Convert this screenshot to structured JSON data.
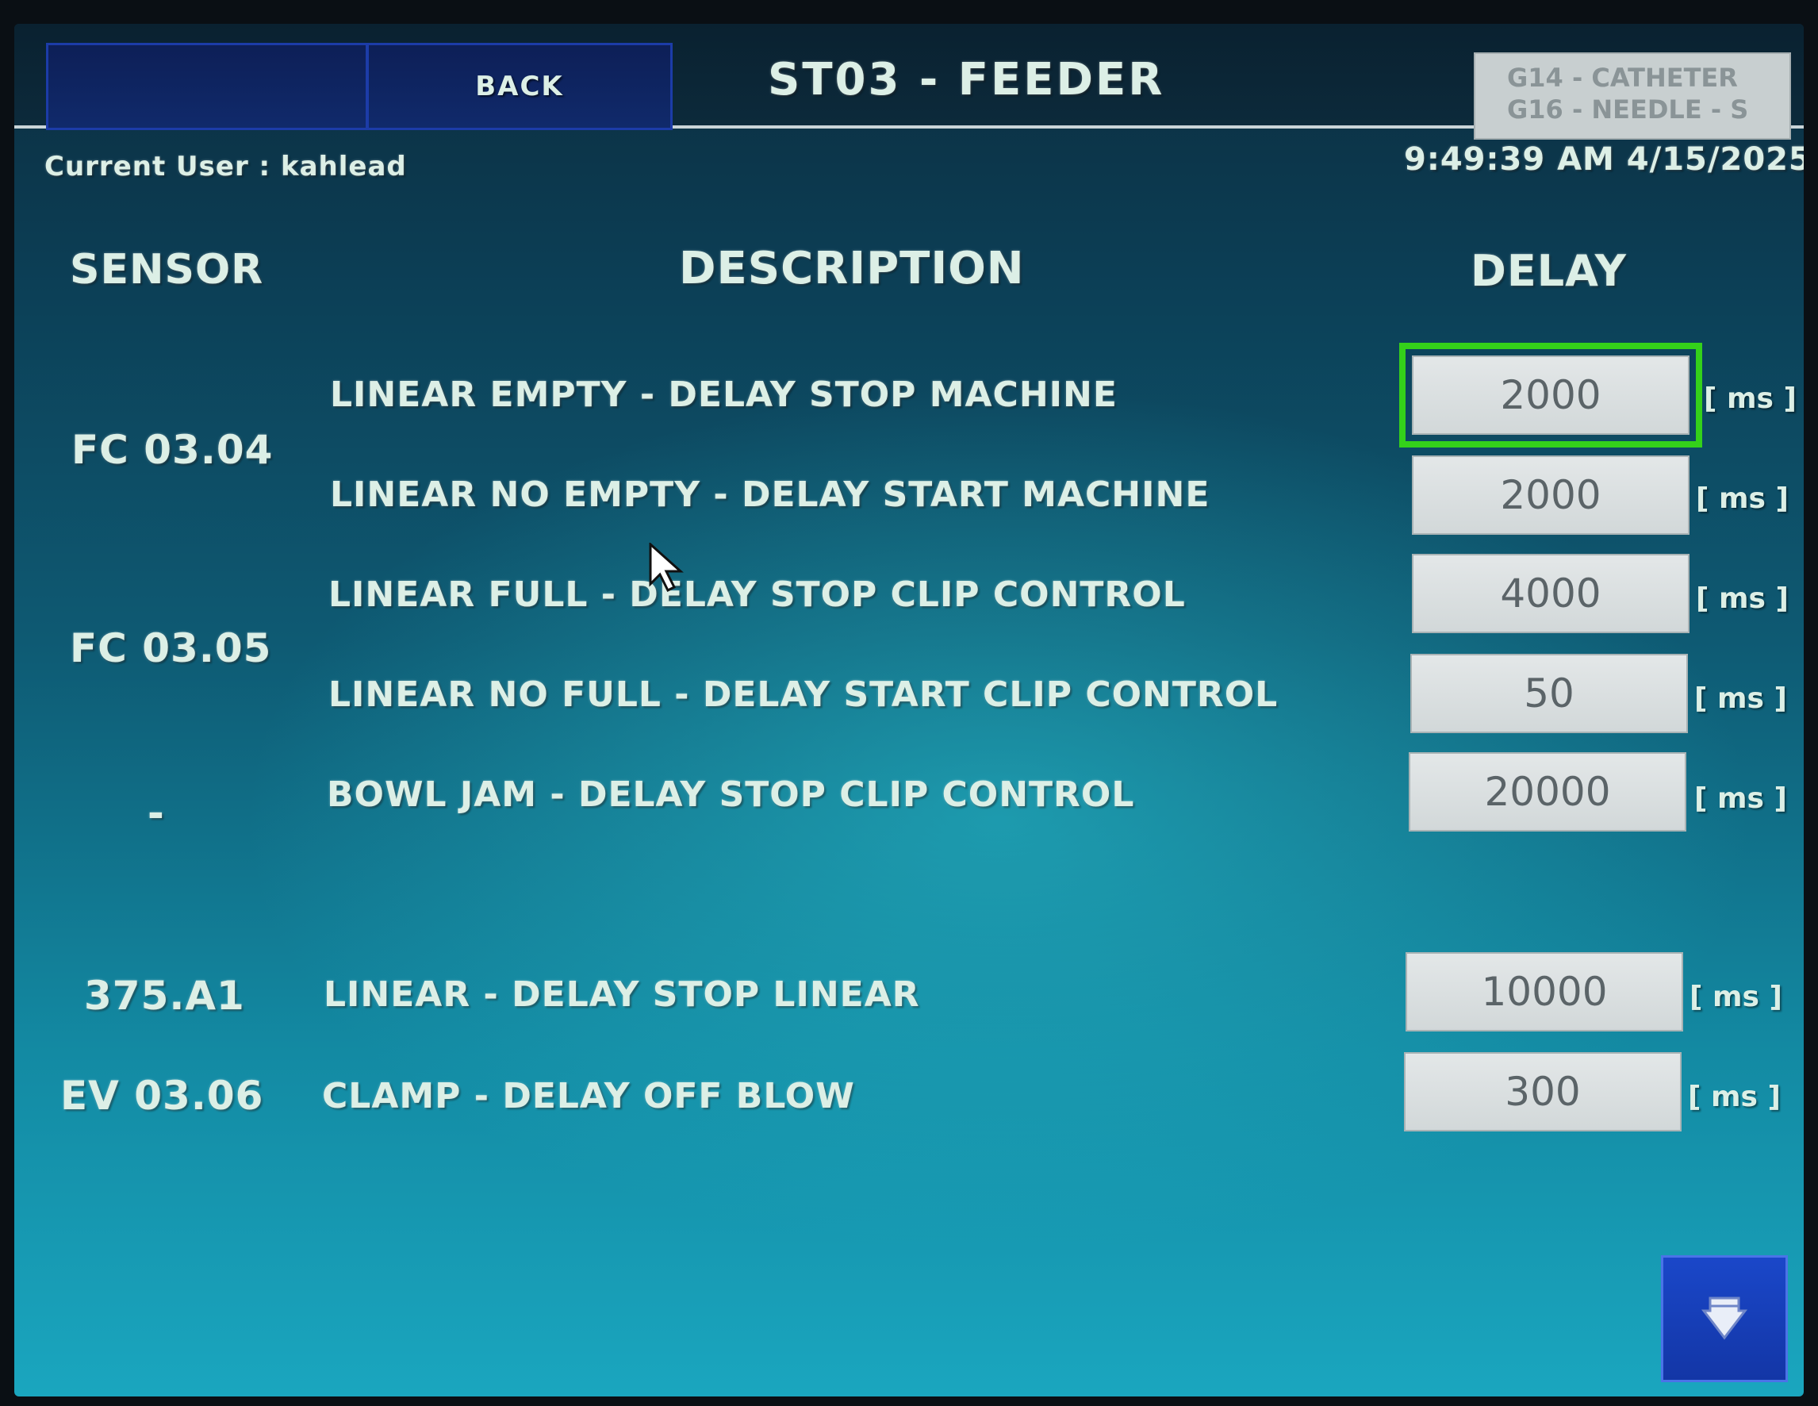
{
  "header": {
    "title": "ST03 - FEEDER",
    "back_label": "BACK",
    "recipe_line1": "G14 - CATHETER",
    "recipe_line2": "G16 - NEEDLE - S"
  },
  "status": {
    "current_user": "Current User : kahlead",
    "datetime": "9:49:39 AM 4/15/2025"
  },
  "columns": {
    "sensor": "SENSOR",
    "description": "DESCRIPTION",
    "delay": "DELAY"
  },
  "sensors": {
    "fc0304": "FC 03.04",
    "fc0305": "FC 03.05",
    "dash": "-",
    "a375": "375.A1",
    "ev0306": "EV 03.06"
  },
  "rows": [
    {
      "description": "LINEAR EMPTY - DELAY STOP MACHINE",
      "value": "2000",
      "unit": "[ ms ]"
    },
    {
      "description": "LINEAR NO EMPTY - DELAY START MACHINE",
      "value": "2000",
      "unit": "[ ms ]"
    },
    {
      "description": "LINEAR FULL - DELAY STOP CLIP CONTROL",
      "value": "4000",
      "unit": "[ ms ]"
    },
    {
      "description": "LINEAR NO FULL - DELAY START CLIP CONTROL",
      "value": "50",
      "unit": "[ ms ]"
    },
    {
      "description": "BOWL JAM - DELAY STOP CLIP CONTROL",
      "value": "20000",
      "unit": "[ ms ]"
    },
    {
      "description": "LINEAR - DELAY STOP LINEAR",
      "value": "10000",
      "unit": "[ ms ]"
    },
    {
      "description": "CLAMP - DELAY OFF BLOW",
      "value": "300",
      "unit": "[ ms ]"
    }
  ],
  "icons": {
    "page_down": "down-arrow-icon",
    "pointer": "mouse-pointer-icon"
  },
  "colors": {
    "selection": "#34d11a",
    "nav_button": "#102a6b",
    "page_down_button": "#1a47c9"
  }
}
